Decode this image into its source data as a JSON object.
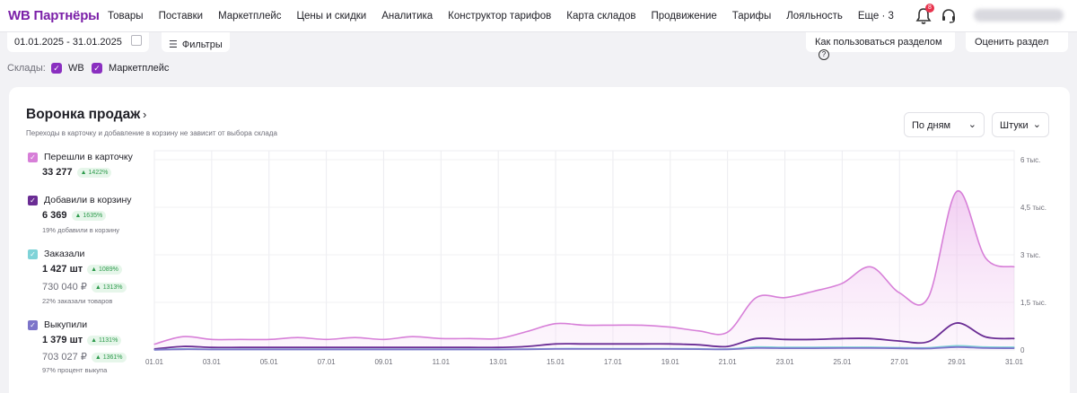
{
  "header": {
    "logo": "WB Партнёры",
    "nav": [
      "Товары",
      "Поставки",
      "Маркетплейс",
      "Цены и скидки",
      "Аналитика",
      "Конструктор тарифов",
      "Карта складов",
      "Продвижение",
      "Тарифы",
      "Лояльность",
      "Еще · 3"
    ],
    "notifications_count": "8"
  },
  "toolbar": {
    "date_range": "01.01.2025 - 31.01.2025",
    "filters_label": "Фильтры",
    "howto_label": "Как пользоваться разделом",
    "rate_label": "Оценить раздел"
  },
  "warehouses": {
    "label": "Склады:",
    "items": [
      "WB",
      "Маркетплейс"
    ]
  },
  "card": {
    "title": "Воронка продаж",
    "subtitle": "Переходы в карточку и добавление в корзину не зависит от выбора склада",
    "period_select": "По дням",
    "unit_select": "Штуки"
  },
  "legend": [
    {
      "name": "Перешли в карточку",
      "value": "33 277",
      "change": "1422%",
      "color": "#d77fd8"
    },
    {
      "name": "Добавили в корзину",
      "value": "6 369",
      "change": "1635%",
      "note": "19% добавили в корзину",
      "color": "#6a2c94"
    },
    {
      "name": "Заказали",
      "value": "1 427 шт",
      "change": "1089%",
      "value2": "730 040 ₽",
      "change2": "1313%",
      "note": "22% заказали товаров",
      "color": "#7fd3d8"
    },
    {
      "name": "Выкупили",
      "value": "1 379 шт",
      "change": "1131%",
      "value2": "703 027 ₽",
      "change2": "1361%",
      "note": "97% процент выкупа",
      "color": "#7c74c9"
    }
  ],
  "chart_data": {
    "type": "area",
    "x": [
      "01.01",
      "02.01",
      "03.01",
      "04.01",
      "05.01",
      "06.01",
      "07.01",
      "08.01",
      "09.01",
      "10.01",
      "11.01",
      "12.01",
      "13.01",
      "14.01",
      "15.01",
      "16.01",
      "17.01",
      "18.01",
      "19.01",
      "20.01",
      "21.01",
      "22.01",
      "23.01",
      "24.01",
      "25.01",
      "26.01",
      "27.01",
      "28.01",
      "29.01",
      "30.01",
      "31.01"
    ],
    "x_tick_labels": [
      "01.01",
      "03.01",
      "05.01",
      "07.01",
      "09.01",
      "11.01",
      "13.01",
      "15.01",
      "17.01",
      "19.01",
      "21.01",
      "23.01",
      "25.01",
      "27.01",
      "29.01",
      "31.01"
    ],
    "y_tick_labels": [
      "0",
      "1,5 тыс.",
      "3 тыс.",
      "4,5 тыс.",
      "6 тыс."
    ],
    "ylim": [
      0,
      6000
    ],
    "series": [
      {
        "name": "Перешли в карточку",
        "color": "#d77fd8",
        "fill": true,
        "values": [
          180,
          420,
          330,
          330,
          330,
          390,
          330,
          390,
          330,
          420,
          360,
          360,
          360,
          580,
          830,
          780,
          780,
          780,
          720,
          600,
          560,
          1650,
          1650,
          1850,
          2100,
          2620,
          1800,
          1650,
          5000,
          2900,
          2620
        ]
      },
      {
        "name": "Добавили в корзину",
        "color": "#6a2c94",
        "values": [
          30,
          110,
          80,
          80,
          80,
          80,
          80,
          80,
          80,
          80,
          80,
          80,
          80,
          110,
          190,
          190,
          190,
          190,
          190,
          160,
          110,
          360,
          330,
          330,
          360,
          360,
          280,
          260,
          850,
          410,
          360
        ]
      },
      {
        "name": "Заказали",
        "color": "#7fd3d8",
        "values": [
          5,
          30,
          20,
          20,
          20,
          20,
          20,
          20,
          20,
          20,
          20,
          20,
          20,
          25,
          40,
          40,
          40,
          40,
          40,
          35,
          25,
          90,
          80,
          80,
          85,
          85,
          70,
          65,
          130,
          90,
          85
        ]
      },
      {
        "name": "Выкупили",
        "color": "#7c74c9",
        "values": [
          3,
          20,
          15,
          15,
          15,
          15,
          15,
          15,
          15,
          15,
          15,
          15,
          15,
          20,
          30,
          30,
          30,
          30,
          30,
          25,
          20,
          60,
          55,
          55,
          60,
          60,
          50,
          45,
          90,
          60,
          55
        ]
      }
    ],
    "grid": true
  }
}
